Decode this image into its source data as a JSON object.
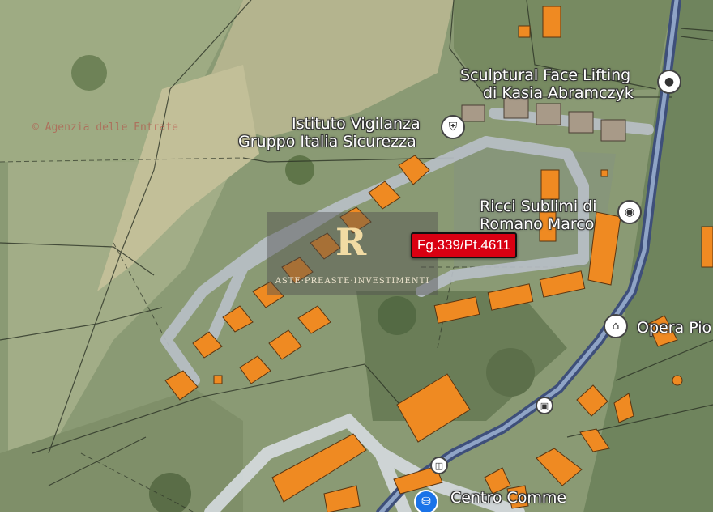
{
  "map": {
    "watermark": "© Agenzia delle Entrate",
    "parcel_label": "Fg.339/Pt.4611",
    "logo": {
      "mark": "R",
      "text": "ASTE·PREASTE·INVESTIMENTI"
    },
    "pois": [
      {
        "name": "Sculptural Face Lifting di Kasia Abramczyk",
        "lines": [
          "Sculptural Face Lifting",
          "di Kasia Abramczyk"
        ],
        "icon": "location-pin-icon"
      },
      {
        "name": "Istituto Vigilanza Gruppo Italia Sicurezza",
        "lines": [
          "Istituto Vigilanza",
          "Gruppo Italia Sicurezza"
        ],
        "icon": "shield-pin-icon"
      },
      {
        "name": "Ricci Sublimi di Romano Marco",
        "lines": [
          "Ricci Sublimi di",
          "Romano Marco"
        ],
        "icon": "pastry-pin-icon"
      },
      {
        "name": "Opera Pio",
        "lines": [
          "Opera Pio"
        ],
        "icon": "church-pin-icon"
      },
      {
        "name": "Centro Comme",
        "lines": [
          "Centro Comme"
        ],
        "icon": "shopping-pin-icon"
      }
    ],
    "colors": {
      "building": "#ef8a22",
      "road": "#b9c0c8",
      "main_road": "#3e4f7a",
      "parcel_badge": "#d90012"
    }
  }
}
